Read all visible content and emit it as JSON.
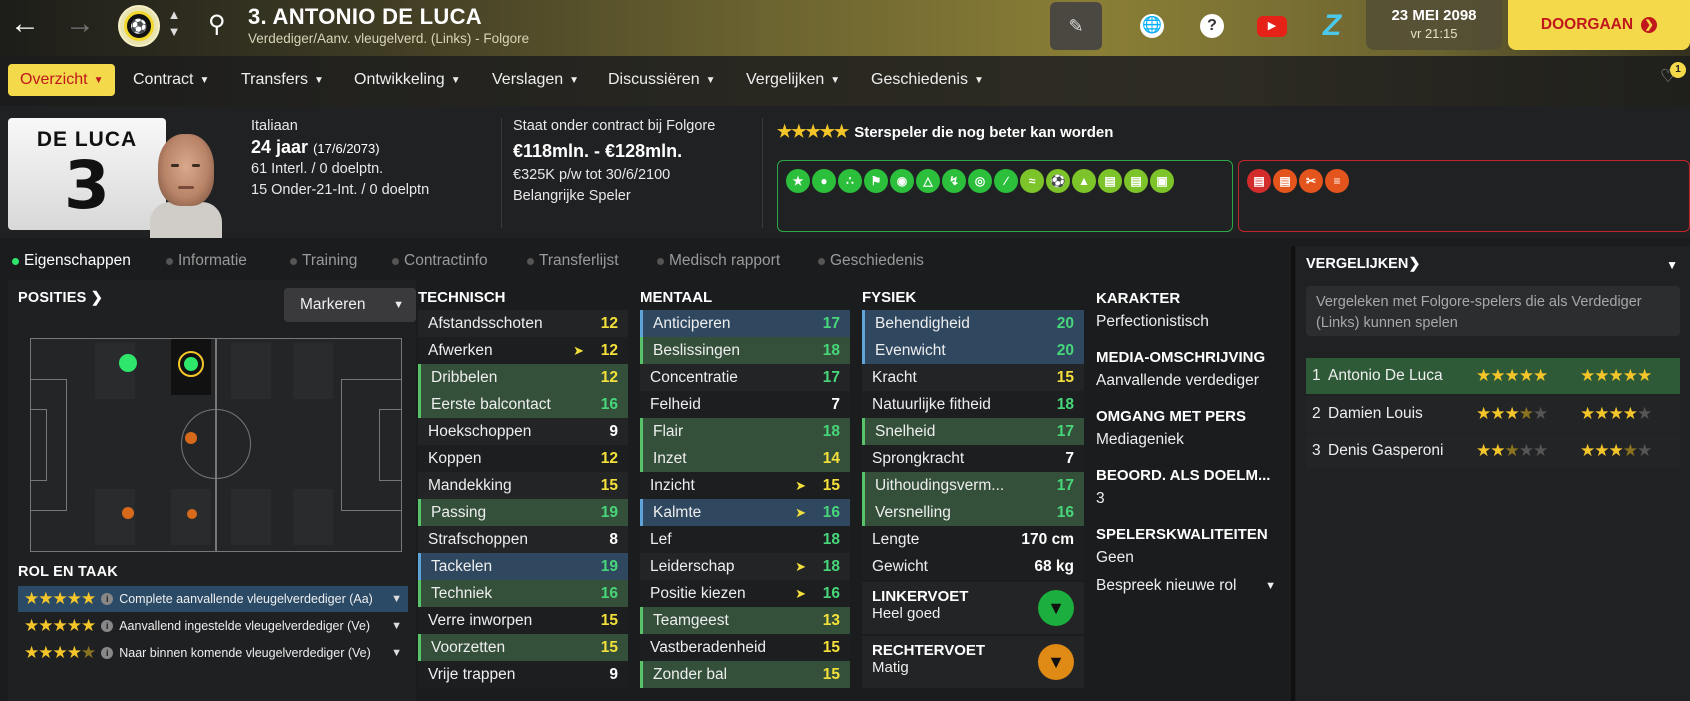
{
  "topbar": {
    "player_title": "3. ANTONIO DE LUCA",
    "player_subtitle": "Verdediger/Aanv. vleugelverd. (Links) - Folgore",
    "date": "23 MEI 2098",
    "time": "vr 21:15",
    "continue_label": "DOORGAAN"
  },
  "nav": {
    "tabs": [
      {
        "label": "Overzicht"
      },
      {
        "label": "Contract"
      },
      {
        "label": "Transfers"
      },
      {
        "label": "Ontwikkeling"
      },
      {
        "label": "Verslagen"
      },
      {
        "label": "Discussiëren"
      },
      {
        "label": "Vergelijken"
      },
      {
        "label": "Geschiedenis"
      }
    ],
    "notification_count": "1"
  },
  "profile": {
    "shirt_name": "DE LUCA",
    "shirt_number": "3",
    "nationality": "Italiaan",
    "age": "24 jaar",
    "dob": "(17/6/2073)",
    "caps": "61 Interl. / 0 doelptn.",
    "u21_caps": "15 Onder-21-Int. / 0 doelptn",
    "contract_club": "Staat onder contract bij Folgore",
    "value": "€118mln. - €128mln.",
    "wage": "€325K p/w tot 30/6/2100",
    "squad_status": "Belangrijke Speler",
    "star_rating_text": "Sterspeler die nog beter kan worden"
  },
  "subtabs": [
    "Eigenschappen",
    "Informatie",
    "Training",
    "Contractinfo",
    "Transferlijst",
    "Medisch rapport",
    "Geschiedenis"
  ],
  "positions": {
    "title": "POSITIES",
    "mark_label": "Markeren"
  },
  "roles": {
    "title": "ROL EN TAAK",
    "items": [
      {
        "label": "Complete aanvallende vleugelverdediger (Aa)"
      },
      {
        "label": "Aanvallend ingestelde vleugelverdediger (Ve)"
      },
      {
        "label": "Naar binnen komende vleugelverdediger (Ve)"
      }
    ]
  },
  "technical": {
    "title": "TECHNISCH",
    "rows": [
      {
        "name": "Afstandsschoten",
        "value": "12"
      },
      {
        "name": "Afwerken",
        "value": "12"
      },
      {
        "name": "Dribbelen",
        "value": "12"
      },
      {
        "name": "Eerste balcontact",
        "value": "16"
      },
      {
        "name": "Hoekschoppen",
        "value": "9"
      },
      {
        "name": "Koppen",
        "value": "12"
      },
      {
        "name": "Mandekking",
        "value": "15"
      },
      {
        "name": "Passing",
        "value": "19"
      },
      {
        "name": "Strafschoppen",
        "value": "8"
      },
      {
        "name": "Tackelen",
        "value": "19"
      },
      {
        "name": "Techniek",
        "value": "16"
      },
      {
        "name": "Verre inworpen",
        "value": "15"
      },
      {
        "name": "Voorzetten",
        "value": "15"
      },
      {
        "name": "Vrije trappen",
        "value": "9"
      }
    ]
  },
  "mental": {
    "title": "MENTAAL",
    "rows": [
      {
        "name": "Anticiperen",
        "value": "17"
      },
      {
        "name": "Beslissingen",
        "value": "18"
      },
      {
        "name": "Concentratie",
        "value": "17"
      },
      {
        "name": "Felheid",
        "value": "7"
      },
      {
        "name": "Flair",
        "value": "18"
      },
      {
        "name": "Inzet",
        "value": "14"
      },
      {
        "name": "Inzicht",
        "value": "15"
      },
      {
        "name": "Kalmte",
        "value": "16"
      },
      {
        "name": "Lef",
        "value": "18"
      },
      {
        "name": "Leiderschap",
        "value": "18"
      },
      {
        "name": "Positie kiezen",
        "value": "16"
      },
      {
        "name": "Teamgeest",
        "value": "13"
      },
      {
        "name": "Vastberadenheid",
        "value": "15"
      },
      {
        "name": "Zonder bal",
        "value": "15"
      }
    ]
  },
  "physical": {
    "title": "FYSIEK",
    "rows": [
      {
        "name": "Behendigheid",
        "value": "20"
      },
      {
        "name": "Evenwicht",
        "value": "20"
      },
      {
        "name": "Kracht",
        "value": "15"
      },
      {
        "name": "Natuurlijke fitheid",
        "value": "18"
      },
      {
        "name": "Snelheid",
        "value": "17"
      },
      {
        "name": "Sprongkracht",
        "value": "7"
      },
      {
        "name": "Uithoudingsverm...",
        "value": "17"
      },
      {
        "name": "Versnelling",
        "value": "16"
      },
      {
        "name": "Lengte",
        "value": "170 cm"
      },
      {
        "name": "Gewicht",
        "value": "68 kg"
      }
    ],
    "left_foot_title": "LINKERVOET",
    "left_foot_value": "Heel goed",
    "right_foot_title": "RECHTERVOET",
    "right_foot_value": "Matig"
  },
  "character": {
    "karakter_title": "KARAKTER",
    "karakter_value": "Perfectionistisch",
    "media_title": "MEDIA-OMSCHRIJVING",
    "media_value": "Aanvallende verdediger",
    "press_title": "OMGANG MET PERS",
    "press_value": "Mediageniek",
    "gk_title": "BEOORD. ALS DOELM...",
    "gk_value": "3",
    "qual_title": "SPELERSKWALITEITEN",
    "qual_value": "Geen",
    "discuss_label": "Bespreek nieuwe rol"
  },
  "compare": {
    "title": "VERGELIJKEN",
    "info": "Vergeleken met Folgore-spelers die als Verdediger (Links) kunnen spelen",
    "rows": [
      {
        "rank": "1",
        "name": "Antonio De Luca",
        "ability": 5,
        "potential": 5
      },
      {
        "rank": "2",
        "name": "Damien Louis",
        "ability": 3.5,
        "potential": 4
      },
      {
        "rank": "3",
        "name": "Denis Gasperoni",
        "ability": 2.5,
        "potential": 3.5
      }
    ]
  },
  "colors": {
    "accent": "#f4d94a",
    "good": "#2bbf3c",
    "bad": "#d22c2c"
  }
}
